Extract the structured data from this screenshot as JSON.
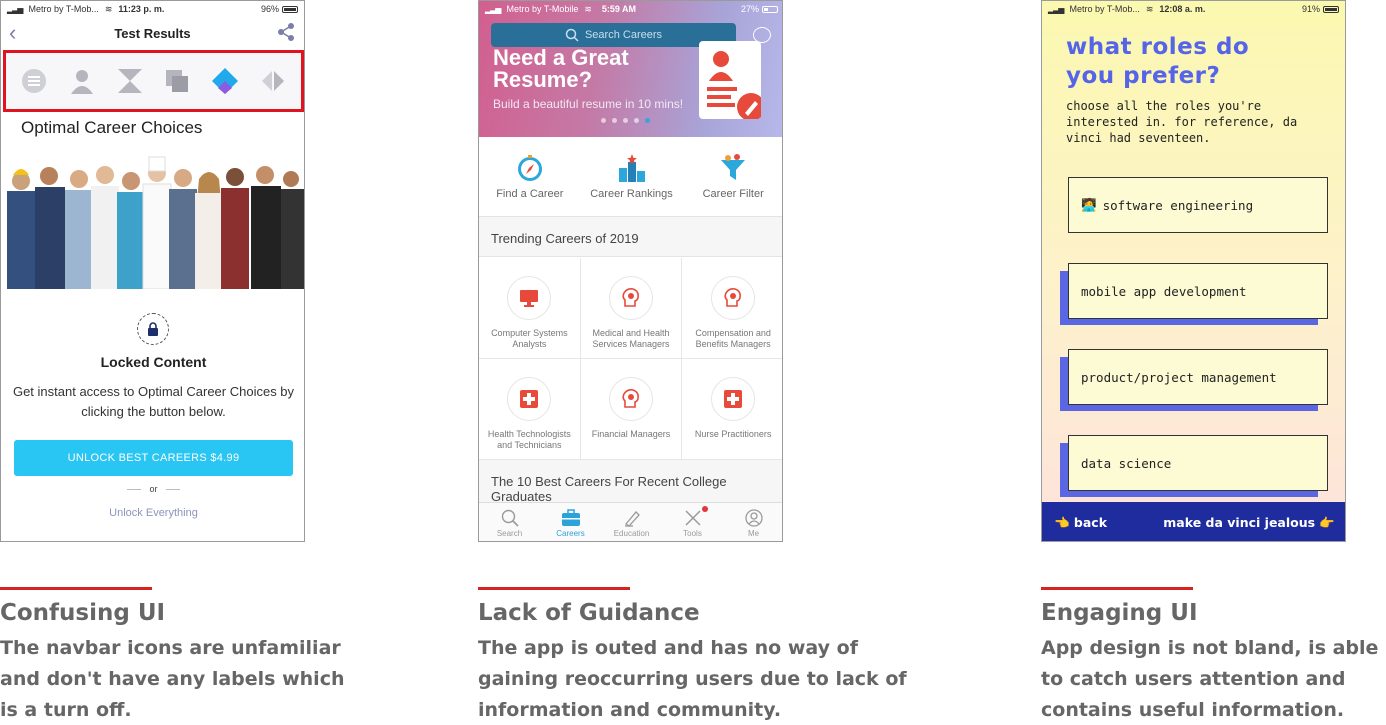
{
  "phone1": {
    "status": {
      "carrier": "Metro by T-Mob...",
      "time": "11:23 p. m.",
      "battery": "96%"
    },
    "title": "Test Results",
    "icons": [
      "list-icon",
      "person-icon",
      "hourglass-icon",
      "layers-icon",
      "diamond-icon",
      "arrows-icon"
    ],
    "section_title": "Optimal Career Choices",
    "locked_title": "Locked Content",
    "locked_desc": "Get instant access to Optimal Career Choices by clicking the button below.",
    "unlock_button": "UNLOCK BEST CAREERS $4.99",
    "or": "or",
    "unlock_everything": "Unlock Everything",
    "colors": {
      "highlight": "#e0141e",
      "button": "#29c5f3",
      "accent": "#8d93bd"
    }
  },
  "phone2": {
    "status": {
      "carrier": "Metro by T-Mobile",
      "time": "5:59 AM",
      "battery": "27%"
    },
    "search_placeholder": "Search Careers",
    "hero_title": "Need a Great Resume?",
    "hero_sub": "Build a beautiful resume in 10 mins!",
    "quick": [
      {
        "label": "Find a Career",
        "icon": "compass-icon"
      },
      {
        "label": "Career Rankings",
        "icon": "podium-icon"
      },
      {
        "label": "Career Filter",
        "icon": "funnel-icon"
      }
    ],
    "trending_title": "Trending Careers of 2019",
    "careers": [
      {
        "label": "Computer Systems Analysts",
        "icon": "monitor-icon"
      },
      {
        "label": "Medical and Health Services Managers",
        "icon": "brain-icon"
      },
      {
        "label": "Compensation and Benefits Managers",
        "icon": "brain-icon"
      },
      {
        "label": "Health Technologists and Technicians",
        "icon": "medical-cross-icon"
      },
      {
        "label": "Financial Managers",
        "icon": "brain-icon"
      },
      {
        "label": "Nurse Practitioners",
        "icon": "medical-cross-icon"
      }
    ],
    "best_title": "The 10 Best Careers For Recent College Graduates",
    "tabs": [
      {
        "label": "Search",
        "icon": "search-icon"
      },
      {
        "label": "Careers",
        "icon": "briefcase-icon",
        "active": true
      },
      {
        "label": "Education",
        "icon": "graduation-icon"
      },
      {
        "label": "Tools",
        "icon": "tools-icon"
      },
      {
        "label": "Me",
        "icon": "profile-icon"
      }
    ],
    "colors": {
      "accent": "#2aa3da",
      "icon": "#e74a3b"
    }
  },
  "phone3": {
    "status": {
      "carrier": "Metro by T-Mob...",
      "time": "12:08 a. m.",
      "battery": "91%"
    },
    "question": "what roles do you prefer?",
    "instruction": "choose all the roles you're interested in. for reference, da vinci had seventeen.",
    "roles": [
      {
        "label": "software engineering",
        "emoji": "🧑‍💻",
        "selected": true
      },
      {
        "label": "mobile app development",
        "selected": false
      },
      {
        "label": "product/project management",
        "selected": false
      },
      {
        "label": "data science",
        "selected": false
      }
    ],
    "back": "👈 back",
    "next": "make da vinci jealous 👉",
    "colors": {
      "title": "#5564e8",
      "footer": "#1e2c9d",
      "shadow": "#5a66e2"
    }
  },
  "captions": [
    {
      "title": "Confusing UI",
      "text": "The navbar icons are unfamiliar and don't have any labels which is a turn off."
    },
    {
      "title": "Lack of Guidance",
      "text": "The app is outed and has no way of gaining reoccurring users due to lack of information and community."
    },
    {
      "title": "Engaging UI",
      "text": "App design is not bland, is able to catch users attention and contains useful information."
    }
  ]
}
